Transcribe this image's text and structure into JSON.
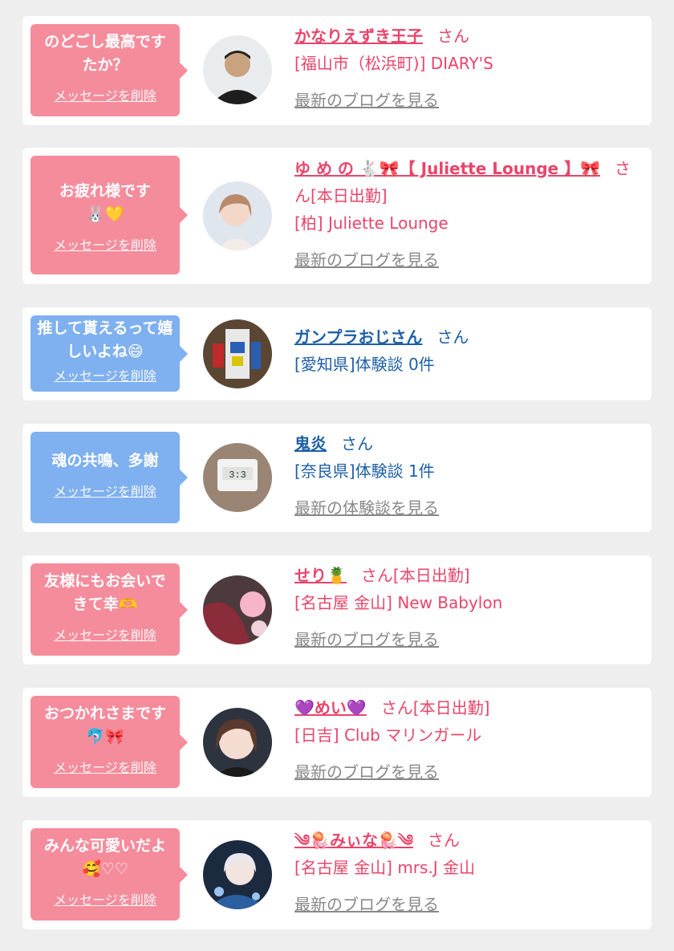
{
  "delete_label": "メッセージを削除",
  "colors": {
    "pink_bubble": "#f58c9c",
    "blue_bubble": "#7fb0f0",
    "pink_text": "#e8456a",
    "blue_text": "#1d5fa6"
  },
  "cards": [
    {
      "message": "のどごし最高ですたか？",
      "name": "かなりえずき王子",
      "suffix": "さん",
      "detail": "[福山市（松浜町)] DIARY'S",
      "link": "最新のブログを見る"
    },
    {
      "message": "お疲れ様です🐰💛",
      "name": "ゆ め の 🐇🎀【 Juliette Lounge 】🎀",
      "suffix": "さ",
      "name_cont": "ん[本日出勤]",
      "detail": "[柏] Juliette Lounge",
      "link": "最新のブログを見る"
    },
    {
      "message": "推して貰えるって嬉しいよね😄",
      "name": "ガンプラおじさん",
      "suffix": "さん",
      "detail": "[愛知県]体験談 0件"
    },
    {
      "message": "魂の共鳴、多謝",
      "name": "鬼炎",
      "suffix": "さん",
      "detail": "[奈良県]体験談 1件",
      "link": "最新の体験談を見る"
    },
    {
      "message": "友様にもお会いできて幸🫶",
      "name": "せり🍍",
      "suffix": "さん[本日出勤]",
      "detail": "[名古屋 金山] New Babylon",
      "link": "最新のブログを見る"
    },
    {
      "message": "おつかれさまです🐬🎀",
      "name": "💜めい💜",
      "suffix": "さん[本日出勤]",
      "detail": "[日吉] Club マリンガール",
      "link": "最新のブログを見る"
    },
    {
      "message": "みんな可愛いだよ🥰♡♡",
      "name": "༄🪼みぃな🪼༄",
      "suffix": "さん",
      "detail": "[名古屋 金山] mrs.J 金山",
      "link": "最新のブログを見る"
    }
  ]
}
